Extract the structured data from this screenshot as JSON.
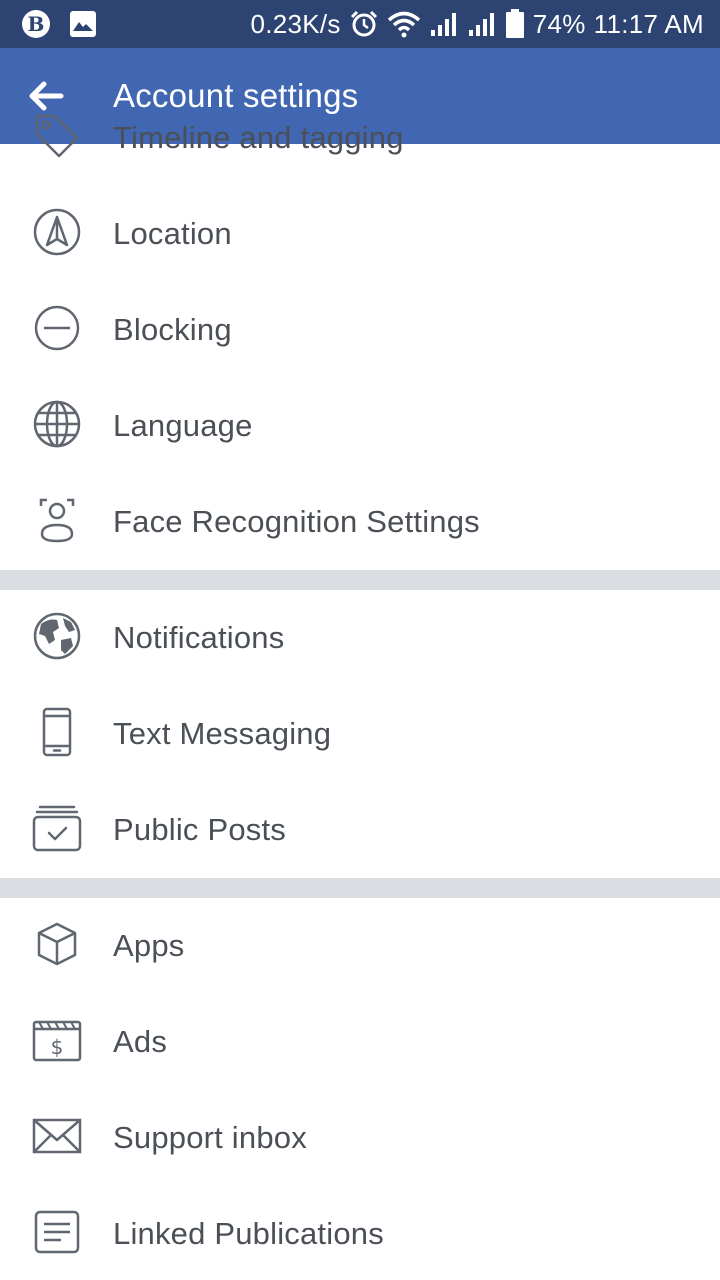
{
  "status_bar": {
    "network_speed": "0.23K/s",
    "battery_percent": "74%",
    "time": "11:17 AM",
    "left_icons": [
      "app-badge-icon",
      "image-icon"
    ],
    "right_icons": [
      "alarm-icon",
      "wifi-icon",
      "signal-icon",
      "signal-icon",
      "battery-icon"
    ]
  },
  "app_bar": {
    "title": "Account settings",
    "back_icon": "arrow-left-icon",
    "background": "#4267b2"
  },
  "sections": [
    {
      "items": [
        {
          "label": "Timeline and tagging",
          "icon": "tag-icon"
        },
        {
          "label": "Location",
          "icon": "location-arrow-icon"
        },
        {
          "label": "Blocking",
          "icon": "block-icon"
        },
        {
          "label": "Language",
          "icon": "globe-icon"
        },
        {
          "label": "Face Recognition Settings",
          "icon": "face-scan-icon"
        }
      ]
    },
    {
      "items": [
        {
          "label": "Notifications",
          "icon": "earth-icon"
        },
        {
          "label": "Text Messaging",
          "icon": "phone-icon"
        },
        {
          "label": "Public Posts",
          "icon": "public-posts-icon"
        }
      ]
    },
    {
      "items": [
        {
          "label": "Apps",
          "icon": "cube-icon"
        },
        {
          "label": "Ads",
          "icon": "ads-dollar-icon"
        },
        {
          "label": "Support inbox",
          "icon": "envelope-icon"
        },
        {
          "label": "Linked Publications",
          "icon": "publication-icon"
        }
      ]
    }
  ],
  "colors": {
    "status_bar": "#2d4372",
    "app_bar": "#4267b2",
    "text": "#4b4f56",
    "icon": "#606770",
    "divider": "#dadde1"
  }
}
